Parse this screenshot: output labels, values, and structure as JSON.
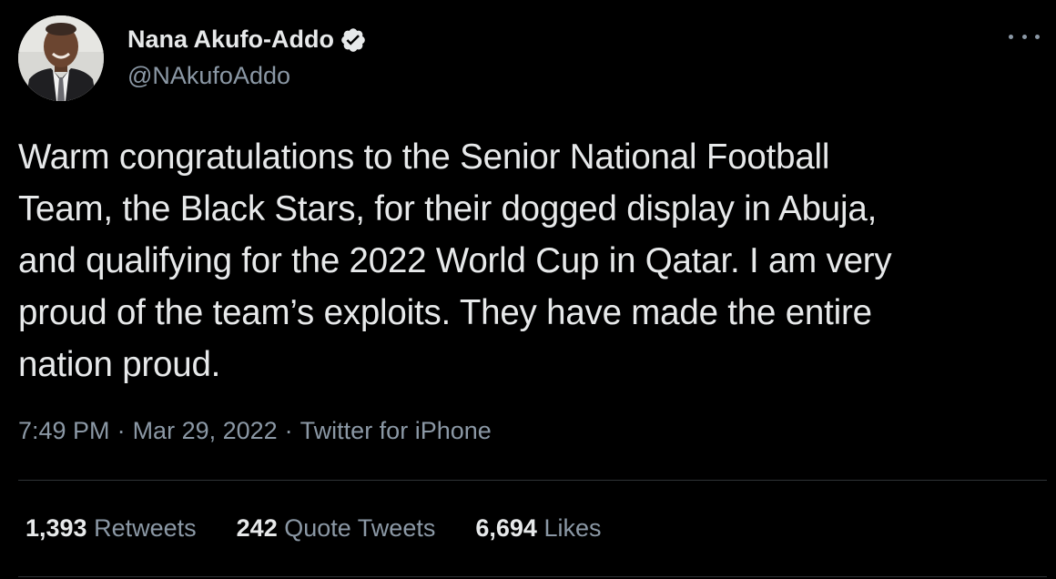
{
  "user": {
    "display_name": "Nana Akufo-Addo",
    "handle": "@NAkufoAddo",
    "verified_icon": "verified-badge-icon"
  },
  "tweet": {
    "lines": [
      "Warm congratulations to the Senior National Football",
      "Team, the Black Stars, for their dogged display in Abuja,",
      "and qualifying for the 2022 World Cup in Qatar. I am very",
      "proud of the team’s exploits. They have made the entire",
      "nation proud."
    ],
    "time": "7:49 PM",
    "separator": "·",
    "date": "Mar 29, 2022",
    "source": "Twitter for iPhone"
  },
  "stats": {
    "retweets_count": "1,393",
    "retweets_label": "Retweets",
    "quotes_count": "242",
    "quotes_label": "Quote Tweets",
    "likes_count": "6,694",
    "likes_label": "Likes"
  },
  "colors": {
    "background": "#000000",
    "text_primary": "#e7e9ea",
    "text_secondary": "#8b98a5",
    "divider": "#2f3336"
  }
}
